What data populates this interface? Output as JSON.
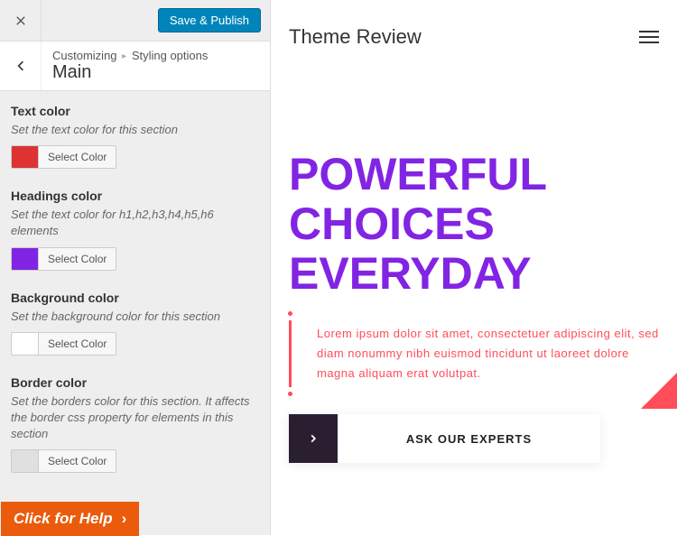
{
  "topbar": {
    "save_label": "Save & Publish"
  },
  "breadcrumb": {
    "root": "Customizing",
    "parent": "Styling options",
    "current": "Main"
  },
  "controls": {
    "text_color": {
      "title": "Text color",
      "desc": "Set the text color for this section",
      "swatch": "#dd3333",
      "button": "Select Color"
    },
    "headings_color": {
      "title": "Headings color",
      "desc": "Set the text color for h1,h2,h3,h4,h5,h6 elements",
      "swatch": "#8224e3",
      "button": "Select Color"
    },
    "background_color": {
      "title": "Background color",
      "desc": "Set the background color for this section",
      "swatch": "#ffffff",
      "button": "Select Color"
    },
    "border_color": {
      "title": "Border color",
      "desc": "Set the borders color for this section. It affects the border css property for elements in this section",
      "swatch": "#e0e0e0",
      "button": "Select Color"
    }
  },
  "help": {
    "label": "Click for Help"
  },
  "preview": {
    "brand": "Theme Review",
    "hero_title": "POWERFUL CHOICES EVERYDAY",
    "lorem": "Lorem ipsum dolor sit amet, consectetuer adipiscing elit, sed diam nonummy nibh euismod tincidunt ut laoreet dolore magna aliquam erat volutpat.",
    "cta_label": "ASK OUR EXPERTS"
  }
}
